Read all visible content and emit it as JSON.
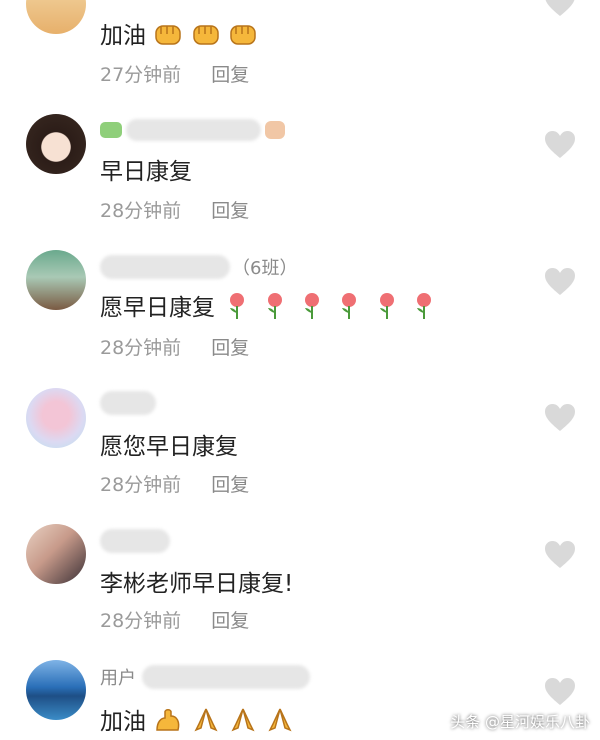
{
  "comments": [
    {
      "text": "加油",
      "time": "27分钟前",
      "reply": "回复",
      "emoji": [
        "fist-emoji",
        "fist-emoji",
        "fist-emoji"
      ]
    },
    {
      "text": "早日康复",
      "time": "28分钟前",
      "reply": "回复"
    },
    {
      "username_suffix": "（6班）",
      "text": "愿早日康复",
      "time": "28分钟前",
      "reply": "回复",
      "emoji": [
        "rose-emoji",
        "rose-emoji",
        "rose-emoji",
        "rose-emoji",
        "rose-emoji",
        "rose-emoji"
      ]
    },
    {
      "text": "愿您早日康复",
      "time": "28分钟前",
      "reply": "回复"
    },
    {
      "text": "李彬老师早日康复!",
      "time": "28分钟前",
      "reply": "回复"
    },
    {
      "username_prefix": "用户",
      "text": "加油",
      "time": "",
      "reply": "",
      "emoji": [
        "flexed-biceps-emoji",
        "praying-hands-emoji",
        "praying-hands-emoji",
        "praying-hands-emoji"
      ]
    }
  ],
  "watermark": "头条 @星河娱乐八卦",
  "colors": {
    "text": "#222222",
    "meta": "#9a9a9a",
    "heart": "#d9d9d9"
  }
}
